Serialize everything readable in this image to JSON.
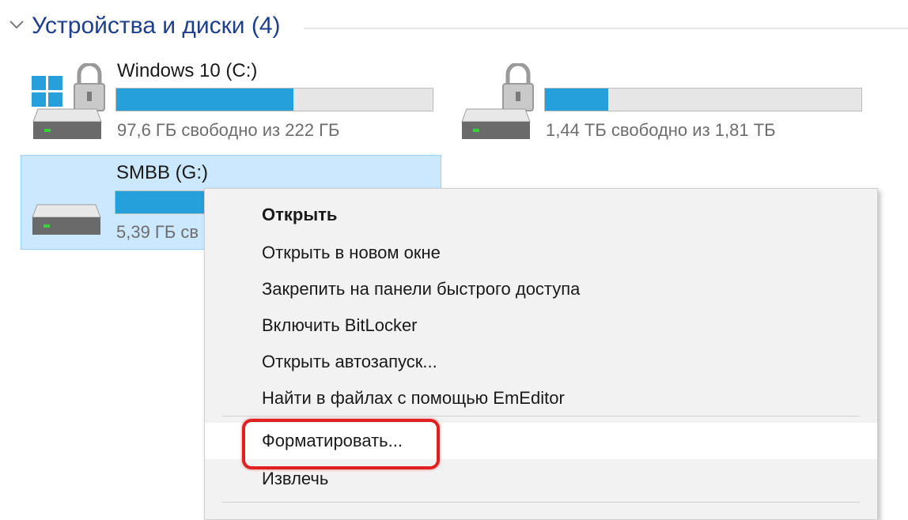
{
  "group": {
    "title": "Устройства и диски (4)"
  },
  "drives": [
    {
      "name": "Windows 10 (C:)",
      "free": "97,6 ГБ свободно из 222 ГБ",
      "used_fraction": 0.56
    },
    {
      "name": "",
      "free": "1,44 ТБ свободно из 1,81 ТБ",
      "used_fraction": 0.2
    },
    {
      "name": "SMBB (G:)",
      "free": "5,39 ГБ св",
      "used_fraction": 0.4
    }
  ],
  "context_menu": {
    "items": [
      {
        "label": "Открыть"
      },
      {
        "label": "Открыть в новом окне"
      },
      {
        "label": "Закрепить на панели быстрого доступа"
      },
      {
        "label": "Включить BitLocker"
      },
      {
        "label": "Открыть автозапуск..."
      },
      {
        "label": "Найти в файлах с помощью EmEditor"
      },
      {
        "label": "Форматировать..."
      },
      {
        "label": "Извлечь"
      }
    ]
  },
  "colors": {
    "accent": "#26a0da",
    "selection": "#cce8ff",
    "highlight": "#e02020",
    "group_title": "#1e3f8c"
  },
  "icons": {
    "windows_logo": "windows-logo-icon",
    "lock": "lock-icon",
    "drive": "hard-drive-icon",
    "chevron": "chevron-down-icon"
  }
}
